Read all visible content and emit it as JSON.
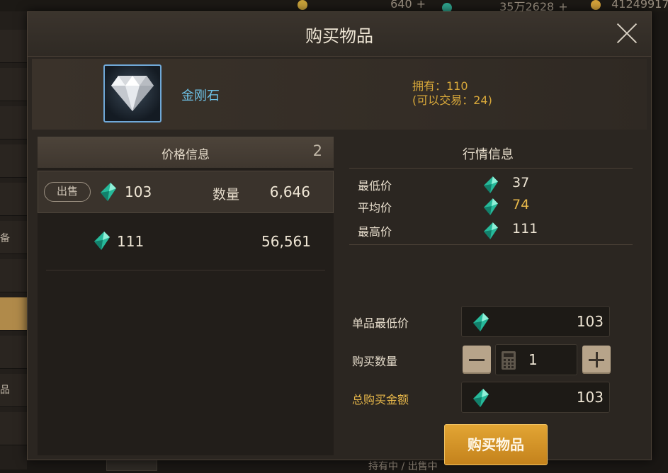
{
  "background": {
    "currency": [
      {
        "value": "640",
        "icon": "moon-coin-icon"
      },
      {
        "value": "35万2628",
        "icon": "gem-icon"
      },
      {
        "value": "41249917",
        "icon": "gold-coin-icon"
      }
    ],
    "side_text": [
      "备",
      "品"
    ],
    "bottom_text": "持有中 / 出售中"
  },
  "modal": {
    "title": "购买物品",
    "item": {
      "name": "金刚石",
      "icon": "diamond-icon",
      "owned": "拥有：110",
      "tradable": "(可以交易：24)"
    },
    "price_info": {
      "title": "价格信息",
      "count": "2",
      "listings": [
        {
          "badge": "出售",
          "price": "103",
          "qty_label": "数量",
          "qty": "6,646"
        },
        {
          "price": "111",
          "qty": "56,561"
        }
      ]
    },
    "market_info": {
      "title": "行情信息",
      "stats": [
        {
          "label": "最低价",
          "value": "37"
        },
        {
          "label": "平均价",
          "value": "74"
        },
        {
          "label": "最高价",
          "value": "111"
        }
      ]
    },
    "purchase": {
      "unit_price_label": "单品最低价",
      "unit_price": "103",
      "qty_label": "购买数量",
      "qty": "1",
      "total_label": "总购买金额",
      "total": "103",
      "buy_label": "购买物品"
    }
  },
  "colors": {
    "gem": "#2fd0b0",
    "accent_gold": "#e8b84a",
    "item_name": "#6ec3e8",
    "button": "#d8962a"
  }
}
